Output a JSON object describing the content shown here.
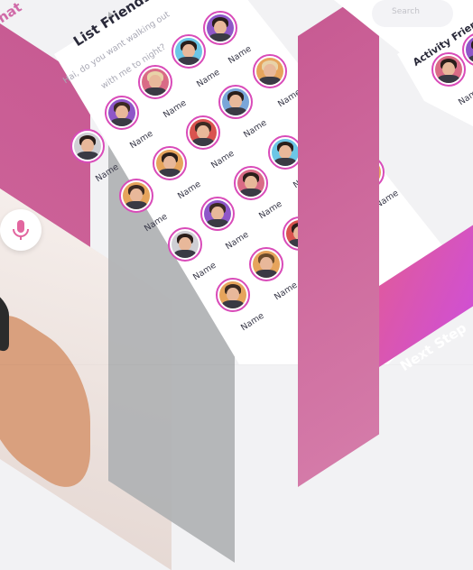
{
  "left_screen": {
    "title_fragment": "hat",
    "mic_icon": "mic-icon"
  },
  "middle_screen": {
    "title": "List Friends",
    "subtitle_line1": "Hai, do you want walking out",
    "subtitle_line2": "with me to night?",
    "friend_label": "Name",
    "next_button": "Next Step"
  },
  "right_screen": {
    "search_placeholder": "Search",
    "section_title": "Activity Friends",
    "friend_label": "Name"
  },
  "colors": {
    "accent_pink": "#d94bb9",
    "gradient_start": "#e05a9c",
    "gradient_end": "#cf4fd6",
    "side_bar": "#c9679a"
  }
}
